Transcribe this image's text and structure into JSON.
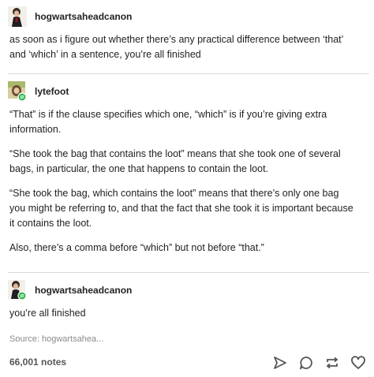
{
  "posts": [
    {
      "username": "hogwartsaheadcanon",
      "paragraphs": [
        "as soon as i figure out whether there’s any practical difference between ‘that’ and ‘which’ in a sentence, you’re all finished"
      ]
    },
    {
      "username": "lytefoot",
      "paragraphs": [
        "“That” is if the clause specifies which one, “which” is if you’re giving extra information.",
        "“She took the bag that contains the loot” means that she took one of several bags, in particular, the one that happens to contain the loot.",
        "“She took the bag, which contains the loot” means that there’s only one bag you might be referring to, and that the fact that she took it is important because it contains the loot.",
        "Also, there’s a comma before “which” but not before “that.”"
      ]
    },
    {
      "username": "hogwartsaheadcanon",
      "paragraphs": [
        "you’re all finished"
      ]
    }
  ],
  "source": {
    "label": "Source:",
    "value": "hogwartsahea..."
  },
  "footer": {
    "notes": "66,001 notes"
  },
  "icons": {
    "share": "paper-plane-icon",
    "reply": "speech-bubble-icon",
    "reblog": "reblog-arrows-icon",
    "like": "heart-icon"
  },
  "colors": {
    "reblog_badge": "#2db84d",
    "divider": "#d9d9d9",
    "muted_text": "#8a8a8a"
  }
}
